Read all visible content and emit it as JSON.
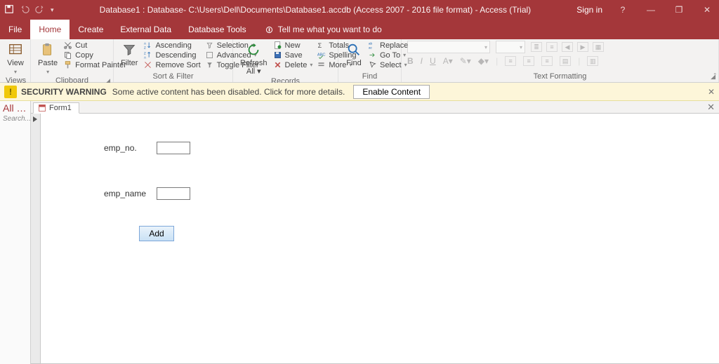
{
  "titlebar": {
    "title": "Database1 : Database- C:\\Users\\Dell\\Documents\\Database1.accdb (Access 2007 - 2016 file format) - Access (Trial)",
    "signin": "Sign in"
  },
  "tabs": {
    "file": "File",
    "home": "Home",
    "create": "Create",
    "external": "External Data",
    "dbtools": "Database Tools",
    "tellme": "Tell me what you want to do"
  },
  "ribbon": {
    "views": {
      "label": "Views",
      "view": "View"
    },
    "clipboard": {
      "label": "Clipboard",
      "paste": "Paste",
      "cut": "Cut",
      "copy": "Copy",
      "painter": "Format Painter"
    },
    "sortfilter": {
      "label": "Sort & Filter",
      "filter": "Filter",
      "asc": "Ascending",
      "desc": "Descending",
      "removesort": "Remove Sort",
      "selection": "Selection",
      "advanced": "Advanced",
      "toggle": "Toggle Filter"
    },
    "records": {
      "label": "Records",
      "refresh": "Refresh\nAll",
      "new": "New",
      "save": "Save",
      "delete": "Delete",
      "totals": "Totals",
      "spelling": "Spelling",
      "more": "More"
    },
    "find": {
      "label": "Find",
      "find": "Find",
      "replace": "Replace",
      "goto": "Go To",
      "select": "Select"
    },
    "textfmt": {
      "label": "Text Formatting"
    }
  },
  "security": {
    "title": "SECURITY WARNING",
    "msg": "Some active content has been disabled. Click for more details.",
    "btn": "Enable Content"
  },
  "nav": {
    "head": "All …",
    "search": "Search..."
  },
  "doc": {
    "tab": "Form1"
  },
  "form": {
    "emp_no_label": "emp_no.",
    "emp_no_value": "",
    "emp_name_label": "emp_name",
    "emp_name_value": "",
    "add": "Add"
  }
}
